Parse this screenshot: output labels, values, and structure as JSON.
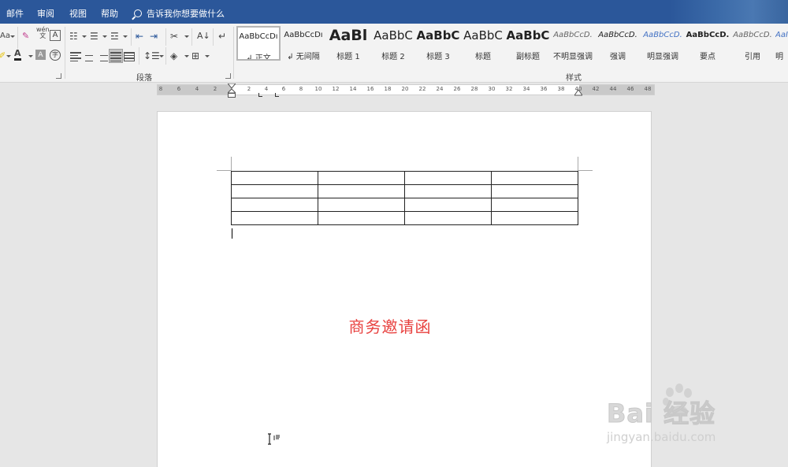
{
  "menubar": {
    "items": [
      "邮件",
      "审阅",
      "视图",
      "帮助"
    ],
    "tell_me": "告诉我你想要做什么"
  },
  "ribbon": {
    "group_paragraph": "段落",
    "group_styles": "样式",
    "font_size_label": "Aa",
    "phonetic_label": "wén",
    "styles": [
      {
        "sample": "AaBbCcDı",
        "name": "↲ 正文",
        "selected": true
      },
      {
        "sample": "AaBbCcDı",
        "name": "↲ 无间隔"
      },
      {
        "sample": "AaBl",
        "name": "标题 1"
      },
      {
        "sample": "AaBbC",
        "name": "标题 2"
      },
      {
        "sample": "AaBbC",
        "name": "标题 3"
      },
      {
        "sample": "AaBbC",
        "name": "标题"
      },
      {
        "sample": "AaBbC",
        "name": "副标题"
      },
      {
        "sample": "AaBbCcD.",
        "name": "不明显强调"
      },
      {
        "sample": "AaBbCcD.",
        "name": "强调"
      },
      {
        "sample": "AaBbCcD.",
        "name": "明显强调"
      },
      {
        "sample": "AaBbCcD.",
        "name": "要点"
      },
      {
        "sample": "AaBbCcD.",
        "name": "引用"
      },
      {
        "sample": "AaI",
        "name": "明"
      }
    ]
  },
  "ruler": {
    "ticks": [
      "8",
      "6",
      "4",
      "2",
      "2",
      "4",
      "6",
      "8",
      "10",
      "12",
      "14",
      "16",
      "18",
      "20",
      "22",
      "24",
      "26",
      "28",
      "30",
      "32",
      "34",
      "36",
      "38",
      "40",
      "42",
      "44",
      "46",
      "48"
    ]
  },
  "document": {
    "title": "商务邀请函",
    "table": {
      "rows": 4,
      "cols": 4
    }
  },
  "watermark": {
    "brand": "Bai 经验",
    "url": "jingyan.baidu.com"
  },
  "colors": {
    "menubar": "#2b579a",
    "title_red": "#e8413f"
  }
}
